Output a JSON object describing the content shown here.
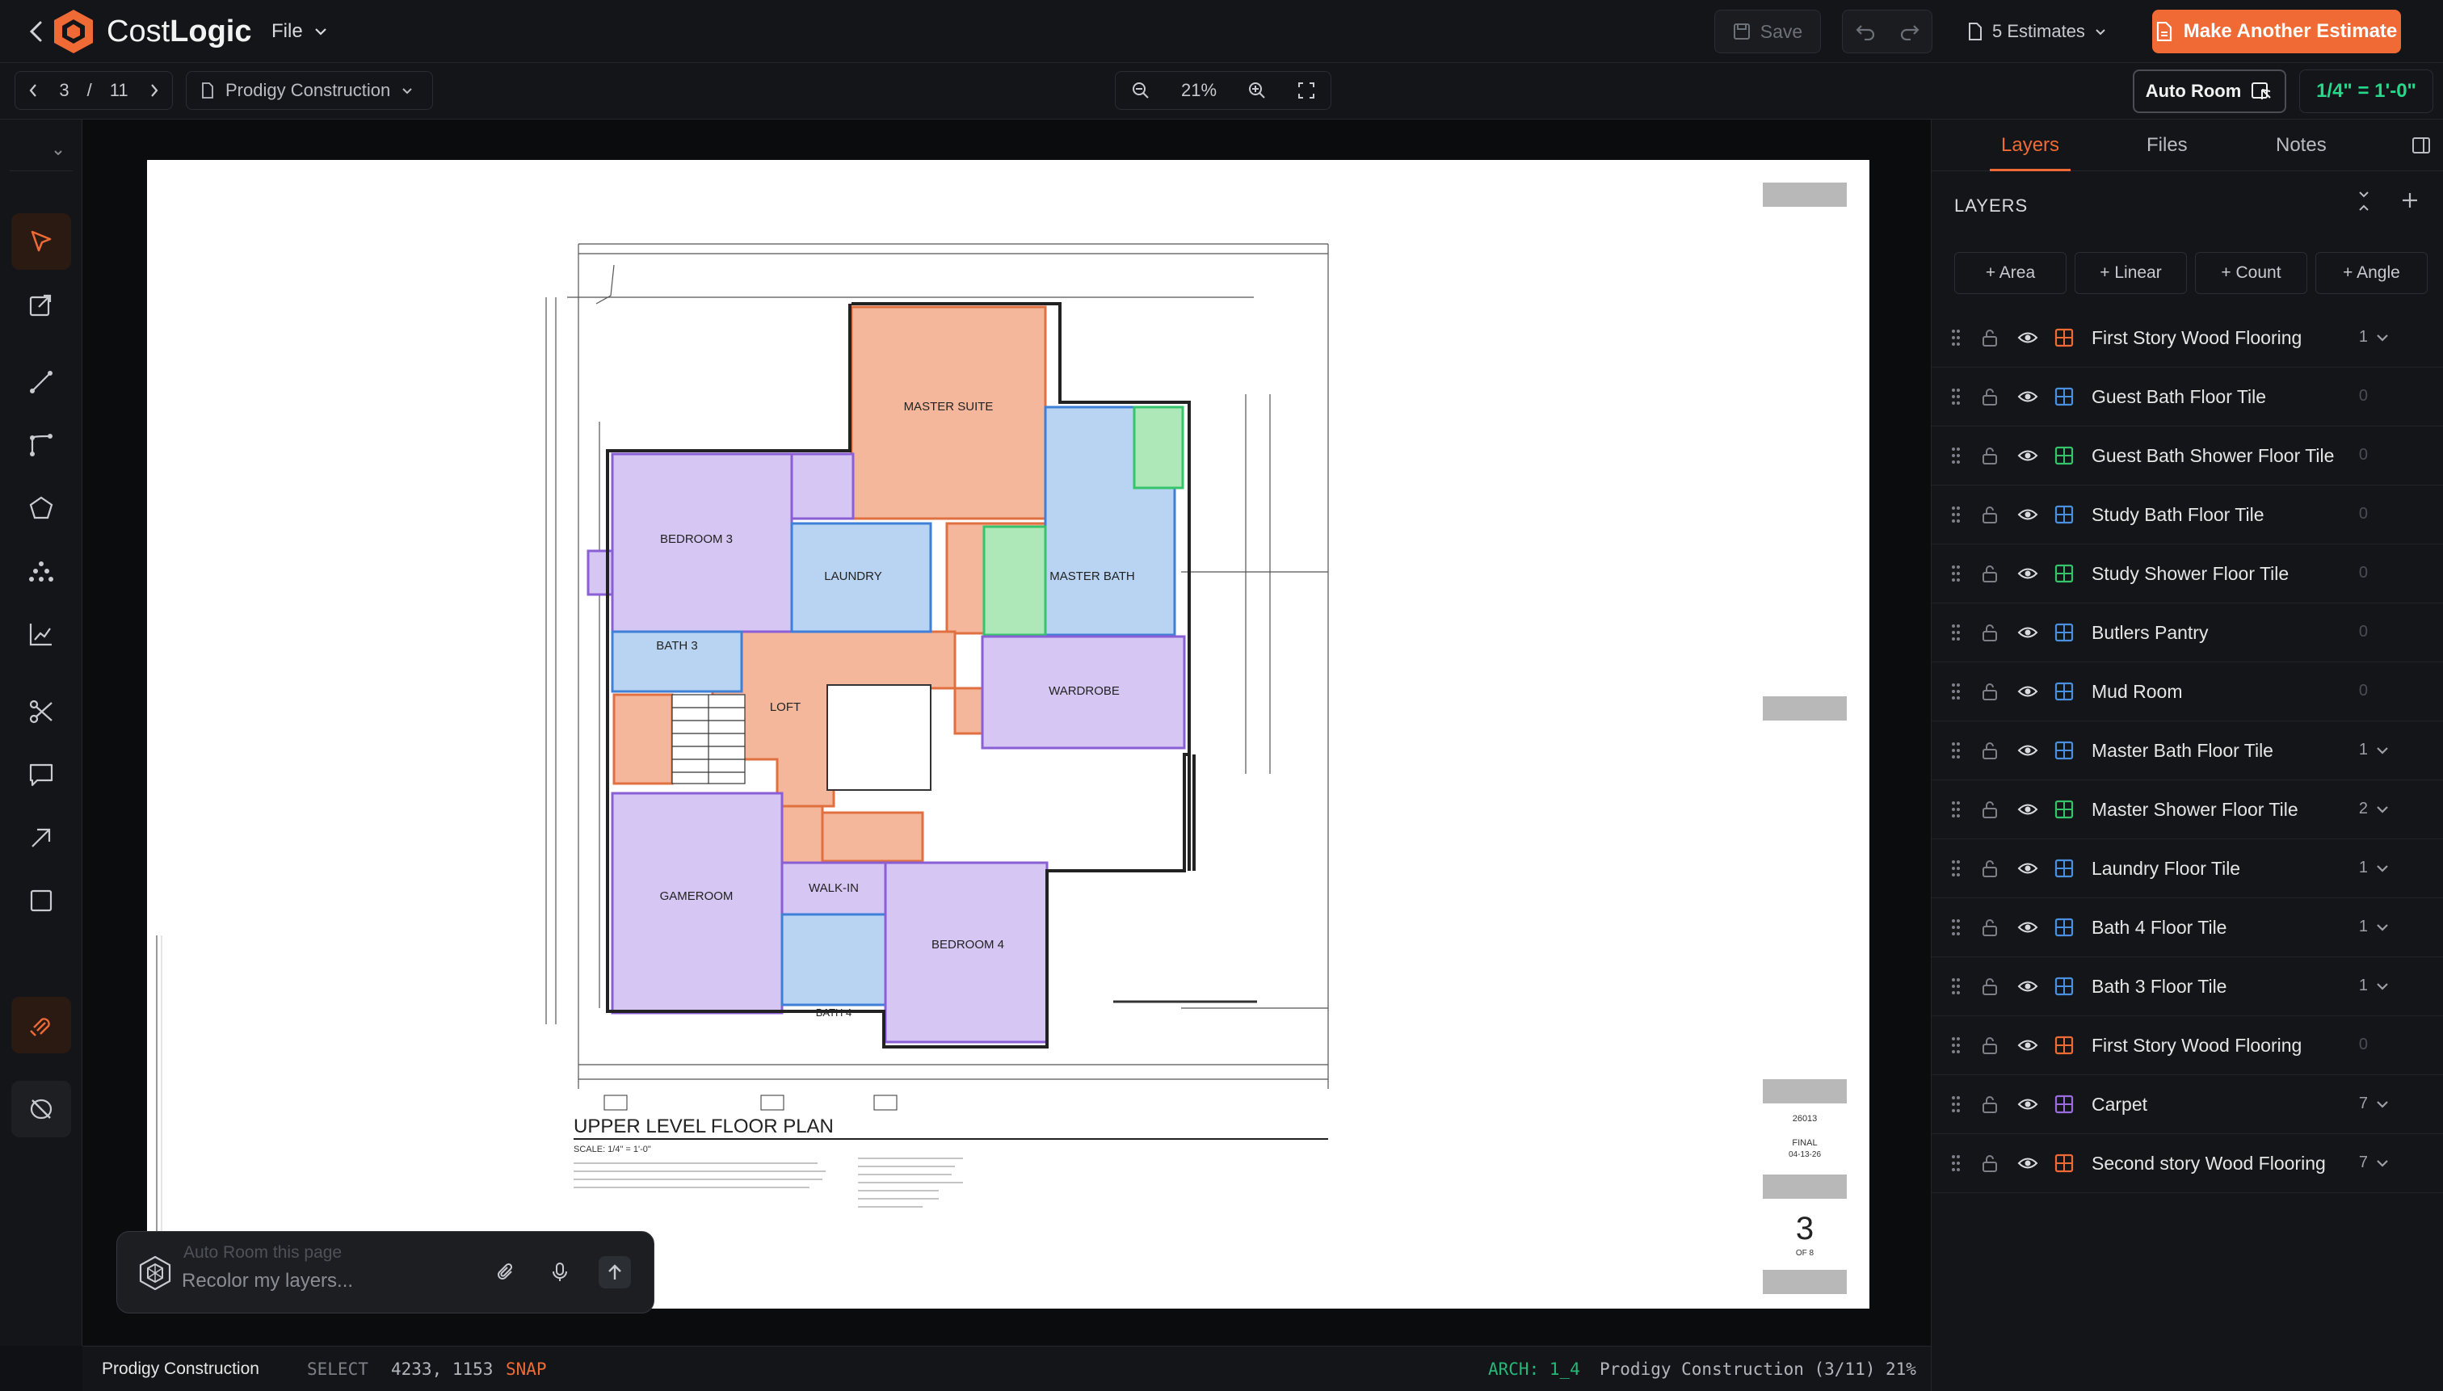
{
  "app": {
    "brand_prefix": "Cost",
    "brand_suffix": "Logic",
    "file_menu": "File"
  },
  "toolbar": {
    "save_label": "Save",
    "estimates_label": "5 Estimates",
    "make_estimate_label": "Make Another Estimate"
  },
  "subbar": {
    "page_current": "3",
    "page_sep": "/",
    "page_total": "11",
    "project": "Prodigy Construction",
    "zoom": "21%",
    "auto_room": "Auto Room",
    "scale": "1/4\" = 1'-0\""
  },
  "drawing": {
    "title": "UPPER LEVEL FLOOR PLAN",
    "scale_note": "SCALE: 1/4\" = 1'-0\"",
    "sheet_number": "3",
    "sheet_of": "OF 8",
    "job_number": "26013",
    "revision": "FINAL",
    "date": "04-13-26",
    "rooms": {
      "master_suite": "MASTER SUITE",
      "bedroom_3": "BEDROOM 3",
      "laundry": "LAUNDRY",
      "master_bath": "MASTER BATH",
      "bath_3": "BATH 3",
      "loft": "LOFT",
      "wardrobe": "WARDROBE",
      "gameroom": "GAMEROOM",
      "walk_in": "WALK-IN",
      "bath_4": "BATH 4",
      "bedroom_4": "BEDROOM 4"
    }
  },
  "prompt": {
    "ghost_text": "Auto Room this page",
    "placeholder": "Recolor my layers..."
  },
  "status": {
    "project": "Prodigy Construction",
    "mode": "SELECT",
    "coords": "4233, 1153",
    "snap": "SNAP",
    "arch": "ARCH: 1_4",
    "project_page": "Prodigy Construction (3/11)",
    "zoom": "21%"
  },
  "panel": {
    "tabs": [
      "Layers",
      "Files",
      "Notes"
    ],
    "heading": "LAYERS",
    "add_buttons": [
      "+ Area",
      "+ Linear",
      "+ Count",
      "+ Angle"
    ],
    "layers": [
      {
        "name": "First Story Wood Flooring",
        "count": "1",
        "color": "#f06a35",
        "expandable": true
      },
      {
        "name": "Guest Bath Floor Tile",
        "count": "0",
        "color": "#4a8fe0",
        "expandable": false
      },
      {
        "name": "Guest Bath Shower Floor Tile",
        "count": "0",
        "color": "#35c46b",
        "expandable": false
      },
      {
        "name": "Study Bath Floor Tile",
        "count": "0",
        "color": "#4a8fe0",
        "expandable": false
      },
      {
        "name": "Study Shower Floor Tile",
        "count": "0",
        "color": "#35c46b",
        "expandable": false
      },
      {
        "name": "Butlers Pantry",
        "count": "0",
        "color": "#4a8fe0",
        "expandable": false
      },
      {
        "name": "Mud Room",
        "count": "0",
        "color": "#4a8fe0",
        "expandable": false
      },
      {
        "name": "Master Bath Floor Tile",
        "count": "1",
        "color": "#4a8fe0",
        "expandable": true
      },
      {
        "name": "Master Shower Floor Tile",
        "count": "2",
        "color": "#35c46b",
        "expandable": true
      },
      {
        "name": "Laundry Floor Tile",
        "count": "1",
        "color": "#4a8fe0",
        "expandable": true
      },
      {
        "name": "Bath 4 Floor Tile",
        "count": "1",
        "color": "#4a8fe0",
        "expandable": true
      },
      {
        "name": "Bath 3 Floor Tile",
        "count": "1",
        "color": "#4a8fe0",
        "expandable": true
      },
      {
        "name": "First Story Wood Flooring",
        "count": "0",
        "color": "#f06a35",
        "expandable": false
      },
      {
        "name": "Carpet",
        "count": "7",
        "color": "#9b6be0",
        "expandable": true
      },
      {
        "name": "Second story Wood Flooring",
        "count": "7",
        "color": "#f06a35",
        "expandable": true
      }
    ]
  },
  "colors": {
    "accent": "#f06a35",
    "scale_green": "#25d98b",
    "area_orange": "#f4b79c",
    "area_blue": "#b9d4f2",
    "area_green": "#aee8b8",
    "area_purple": "#d6c6f3"
  }
}
